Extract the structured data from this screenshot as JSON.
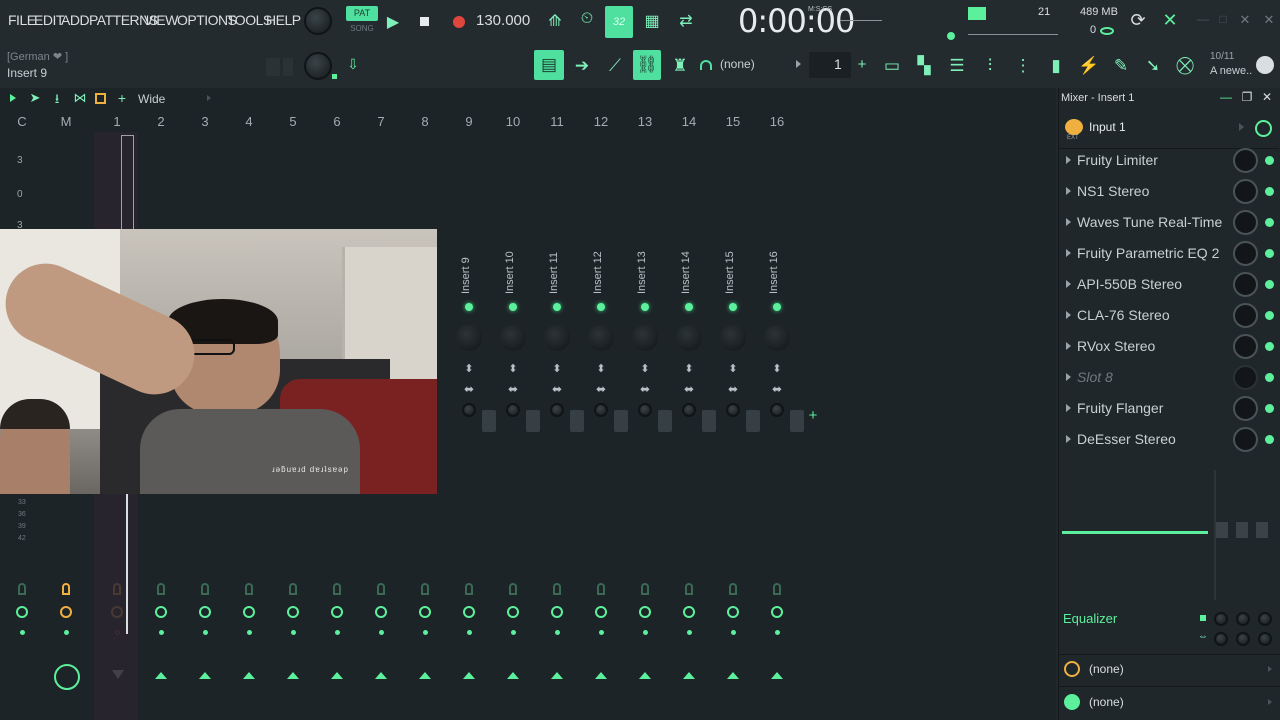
{
  "menu": [
    "FILE",
    "EDIT",
    "ADD",
    "PATTERNS",
    "VIEW",
    "OPTIONS",
    "TOOLS",
    "HELP"
  ],
  "transport": {
    "pat_label": "PAT",
    "song_label": "SONG",
    "tempo": "130.000",
    "time": "0:00:00",
    "time_format": "M:S:CS",
    "pattern_num": "32"
  },
  "status": {
    "cpu": "21",
    "memory": "489 MB",
    "voices": "0"
  },
  "hint": {
    "line1": "[German ❤     ]",
    "line2": "Insert 9"
  },
  "toolbar2": {
    "pattern_selector": "(none)",
    "pattern_number": "1",
    "news_date": "10/11",
    "news_text": "A newe.."
  },
  "mixer": {
    "view_mode": "Wide",
    "track_headers": [
      "C",
      "M",
      "1",
      "2",
      "3",
      "4",
      "5",
      "6",
      "7",
      "8",
      "9",
      "10",
      "11",
      "12",
      "13",
      "14",
      "15",
      "16"
    ],
    "meter_labels": [
      "3",
      "0",
      "3"
    ],
    "meter_labels_low": [
      "33",
      "36",
      "39",
      "42"
    ],
    "insert_names": [
      "Insert 9",
      "Insert 10",
      "Insert 11",
      "Insert 12",
      "Insert 13",
      "Insert 14",
      "Insert 15",
      "Insert 16"
    ],
    "video_caption": "ɹəƃuɐɹd dɐɹʇsɐəp"
  },
  "panel": {
    "title": "Mixer - Insert 1",
    "input": "Input 1",
    "ext_label": "EXT",
    "slots": [
      {
        "name": "Fruity Limiter",
        "empty": false
      },
      {
        "name": "NS1 Stereo",
        "empty": false
      },
      {
        "name": "Waves Tune Real-Time S..",
        "empty": false
      },
      {
        "name": "Fruity Parametric EQ 2",
        "empty": false
      },
      {
        "name": "API-550B Stereo",
        "empty": false
      },
      {
        "name": "CLA-76 Stereo",
        "empty": false
      },
      {
        "name": "RVox Stereo",
        "empty": false
      },
      {
        "name": "Slot 8",
        "empty": true
      },
      {
        "name": "Fruity Flanger",
        "empty": false
      },
      {
        "name": "DeEsser Stereo",
        "empty": false
      }
    ],
    "equalizer_label": "Equalizer",
    "out1": "(none)",
    "out2": "(none)"
  },
  "colors": {
    "accent": "#4fe0a0",
    "led": "#5cf09c",
    "orange": "#f0b040",
    "bg": "#20282c"
  }
}
